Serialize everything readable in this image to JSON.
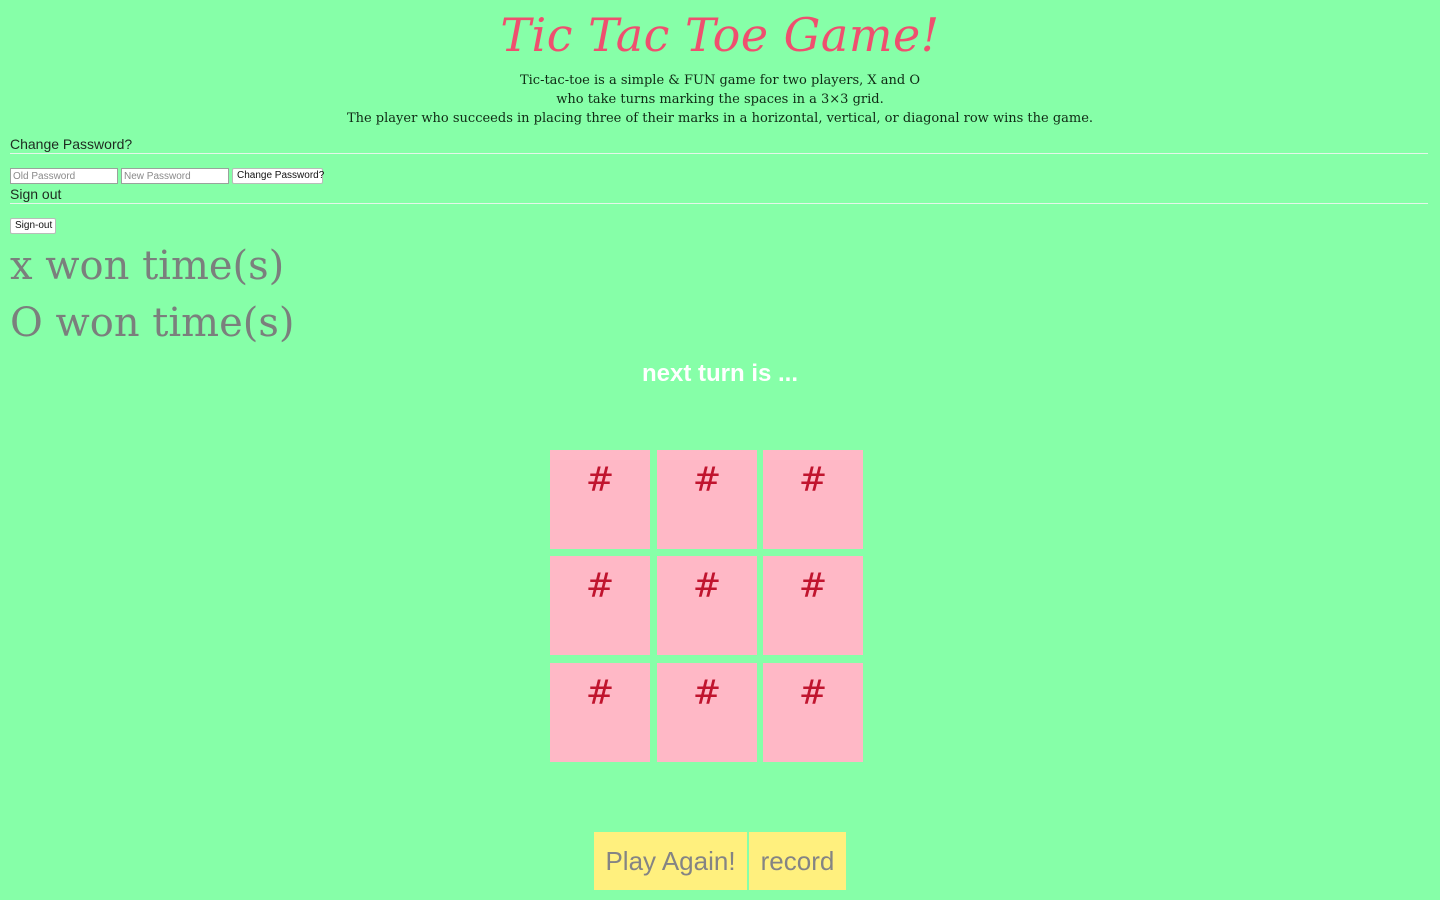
{
  "header": {
    "title": "Tic Tac Toe Game!",
    "description": [
      "Tic-tac-toe is a simple & FUN game for two players, X and O",
      "who take turns marking the spaces in a 3×3 grid.",
      "The player who succeeds in placing three of their marks in a horizontal, vertical, or diagonal row wins the game."
    ]
  },
  "change_password": {
    "heading": "Change Password?",
    "old_placeholder": "Old Password",
    "new_placeholder": "New Password",
    "button_label": "Change Password?"
  },
  "sign_out": {
    "heading": "Sign out",
    "button_label": "Sign-out"
  },
  "scores": {
    "x_label": "x won time(s)",
    "o_label": "O won time(s)"
  },
  "turn": {
    "text": "next turn is ..."
  },
  "board": {
    "cells": [
      "#",
      "#",
      "#",
      "#",
      "#",
      "#",
      "#",
      "#",
      "#"
    ]
  },
  "actions": {
    "play_again": "Play Again!",
    "record": "record"
  },
  "colors": {
    "background": "#86ffa8",
    "title": "#ef4f6f",
    "cell_background": "#ffb8c6",
    "cell_mark": "#c0142e",
    "action_button": "#fff07e"
  }
}
